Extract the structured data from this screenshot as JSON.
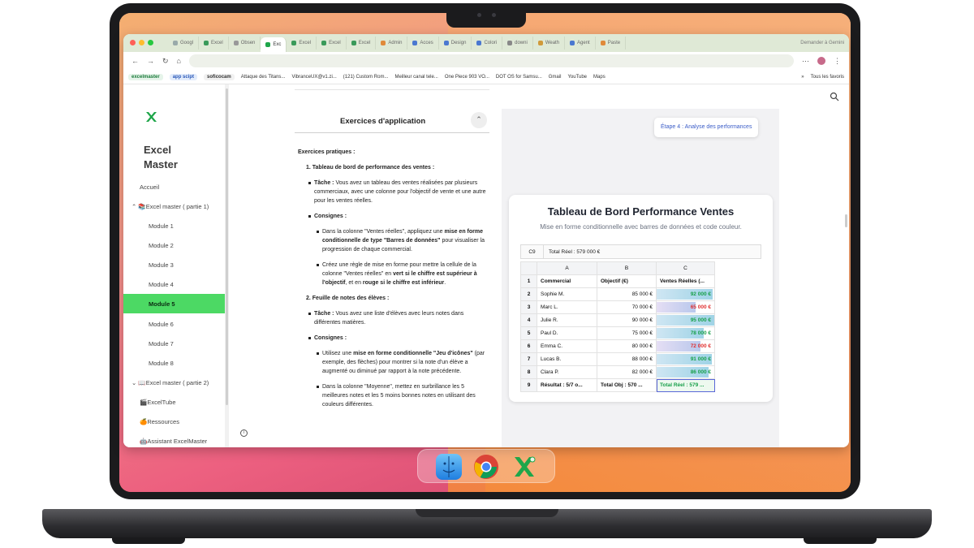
{
  "browser": {
    "tabs": [
      "Googl",
      "Excel",
      "Obsen",
      "Exc",
      "Excel",
      "Excel",
      "Excel",
      "Admin",
      "Acces",
      "Design",
      "Colori",
      "downi",
      "Weath",
      "Agent",
      "Paste"
    ],
    "active_tab_index": 3,
    "gemini_label": "Demander à Gemini",
    "bookmarks": [
      "excelmaster",
      "app scipt",
      "soficocam",
      "Attaque des Titans...",
      "VibranceUX@v1.zi...",
      "(121) Custom Rom...",
      "Meilleur canal tele...",
      "One Piece 903 VO...",
      "DOT OS for Samsu...",
      "Gmail",
      "YouTube",
      "Maps"
    ],
    "bookmarks_more": "»",
    "all_bookmarks": "Tous les favoris"
  },
  "sidebar": {
    "brand_line1": "Excel",
    "brand_line2": "Master",
    "items": [
      {
        "label": "Accueil"
      },
      {
        "label": "Excel master ( partie 1)"
      },
      {
        "label": "Module 1"
      },
      {
        "label": "Module 2"
      },
      {
        "label": "Module 3"
      },
      {
        "label": "Module 4"
      },
      {
        "label": "Module 5"
      },
      {
        "label": "Module 6"
      },
      {
        "label": "Module 7"
      },
      {
        "label": "Module 8"
      },
      {
        "label": "Excel master ( partie 2)"
      },
      {
        "label": "ExcelTube"
      },
      {
        "label": "Ressources"
      },
      {
        "label": "Assistant ExcelMaster"
      }
    ],
    "active_item": "Module 5"
  },
  "exercises": {
    "title": "Exercices d'application",
    "heading": "Exercices pratiques :",
    "ex1_title": "1. Tableau de bord de performance des ventes :",
    "ex1_task_label": "Tâche :",
    "ex1_task": "Vous avez un tableau des ventes réalisées par plusieurs commerciaux, avec une colonne pour l'objectif de vente et une autre pour les ventes réelles.",
    "consignes": "Consignes :",
    "ex1_c1_a": "Dans la colonne \"Ventes réelles\", appliquez une",
    "ex1_c1_b": "mise en forme conditionnelle de type \"Barres de données\"",
    "ex1_c1_c": "pour visualiser la progression de chaque commercial.",
    "ex1_c2_a": "Créez une règle de mise en forme pour mettre la cellule de la colonne \"Ventes réelles\" en",
    "ex1_c2_b": "vert si le chiffre est supérieur à l'objectif",
    "ex1_c2_c": ", et en",
    "ex1_c2_d": "rouge si le chiffre est inférieur",
    "ex1_c2_e": ".",
    "ex2_title": "2. Feuille de notes des élèves :",
    "ex2_task_label": "Tâche :",
    "ex2_task": "Vous avez une liste d'élèves avec leurs notes dans différentes matières.",
    "ex2_c1_a": "Utilisez une",
    "ex2_c1_b": "mise en forme conditionnelle \"Jeu d'icônes\"",
    "ex2_c1_c": "(par exemple, des flèches) pour montrer si la note d'un élève a augmenté ou diminué par rapport à la note précédente.",
    "ex2_c2": "Dans la colonne \"Moyenne\", mettez en surbrillance les 5 meilleures notes et les 5 moins bonnes notes en utilisant des couleurs différentes."
  },
  "preview": {
    "etape_label": "Étape 4 : Analyse des performances",
    "card_title": "Tableau de Bord Performance Ventes",
    "card_subtitle": "Mise en forme conditionnelle avec barres de données et code couleur.",
    "formula_cell": "C9",
    "formula_value": "Total Réel : 579 000 €",
    "columns": [
      "A",
      "B",
      "C"
    ],
    "header_row": {
      "n": "1",
      "a": "Commercial",
      "b": "Objectif (€)",
      "c": "Ventes Réelles (..."
    },
    "rows": [
      {
        "n": "2",
        "name": "Sophie M.",
        "objectif": "85 000 €",
        "reel": "92 000 €",
        "status": "above",
        "fill": 0.97
      },
      {
        "n": "3",
        "name": "Marc L.",
        "objectif": "70 000 €",
        "reel": "65 000 €",
        "status": "below",
        "fill": 0.68
      },
      {
        "n": "4",
        "name": "Julie R.",
        "objectif": "90 000 €",
        "reel": "95 000 €",
        "status": "above",
        "fill": 1.0
      },
      {
        "n": "5",
        "name": "Paul D.",
        "objectif": "75 000 €",
        "reel": "78 000 €",
        "status": "above",
        "fill": 0.82
      },
      {
        "n": "6",
        "name": "Emma C.",
        "objectif": "80 000 €",
        "reel": "72 000 €",
        "status": "below",
        "fill": 0.76
      },
      {
        "n": "7",
        "name": "Lucas B.",
        "objectif": "88 000 €",
        "reel": "91 000 €",
        "status": "above",
        "fill": 0.96
      },
      {
        "n": "8",
        "name": "Clara P.",
        "objectif": "82 000 €",
        "reel": "86 000 €",
        "status": "above",
        "fill": 0.9
      }
    ],
    "result_row": {
      "n": "9",
      "a": "Résultat : 5/7 o...",
      "b": "Total Obj : 570 ...",
      "c": "Total Réel : 579 ..."
    }
  },
  "colors": {
    "accent_green": "#4cd964",
    "above": "#18a04a",
    "below": "#e03030",
    "link_blue": "#3a5cc7"
  },
  "icons": [
    "search-icon",
    "info-icon",
    "chevron-up-icon",
    "excel-logo-icon",
    "finder-icon",
    "chrome-icon",
    "excelmaster-app-icon"
  ]
}
